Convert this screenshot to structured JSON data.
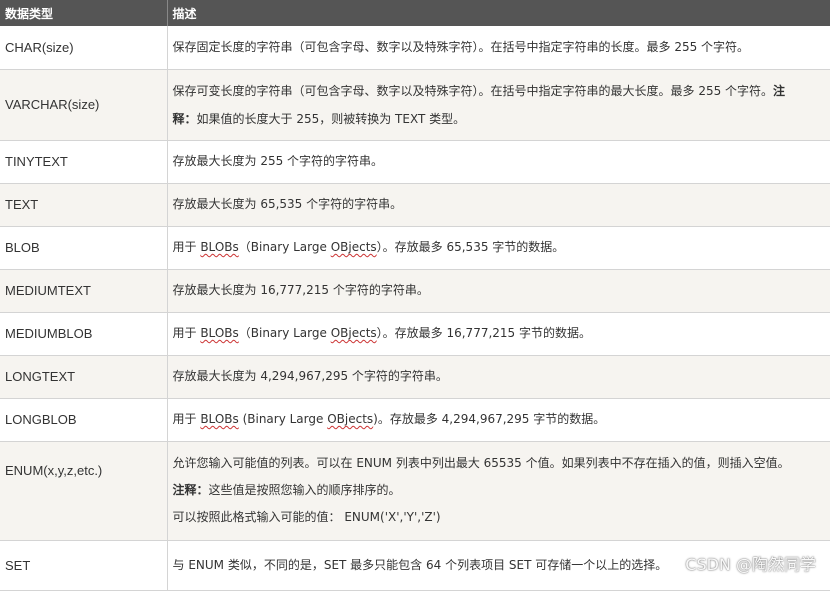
{
  "header": {
    "col_type": "数据类型",
    "col_desc": "描述"
  },
  "rows": [
    {
      "name": "CHAR(size)",
      "desc": "保存固定长度的字符串（可包含字母、数字以及特殊字符）。在括号中指定字符串的长度。最多 255 个字符。"
    },
    {
      "name": "VARCHAR(size)",
      "desc_a": "保存可变长度的字符串（可包含字母、数字以及特殊字符）。在括号中指定字符串的最大长度。最多 255 个字符。",
      "note_a": "注",
      "note_b": "释：",
      "desc_b": "如果值的长度大于 255，则被转换为 TEXT 类型。"
    },
    {
      "name": "TINYTEXT",
      "desc": "存放最大长度为 255 个字符的字符串。"
    },
    {
      "name": "TEXT",
      "desc": "存放最大长度为 65,535 个字符的字符串。"
    },
    {
      "name": "BLOB",
      "pre": "用于 ",
      "link": "BLOBs",
      "mid": "（Binary Large ",
      "link2": "OBjects",
      "post": "）。存放最多 65,535 字节的数据。"
    },
    {
      "name": "MEDIUMTEXT",
      "desc": "存放最大长度为 16,777,215 个字符的字符串。"
    },
    {
      "name": "MEDIUMBLOB",
      "pre": "用于 ",
      "link": "BLOBs",
      "mid": "（Binary Large ",
      "link2": "OBjects",
      "post": "）。存放最多 16,777,215 字节的数据。"
    },
    {
      "name": "LONGTEXT",
      "desc": "存放最大长度为 4,294,967,295 个字符的字符串。"
    },
    {
      "name": "LONGBLOB",
      "pre": "用于 ",
      "link": "BLOBs",
      "mid": " (Binary Large ",
      "link2": "OBjects",
      "post": ")。存放最多 4,294,967,295 字节的数据。"
    },
    {
      "name": "ENUM(x,y,z,etc.)",
      "line1": "允许您输入可能值的列表。可以在 ENUM 列表中列出最大 65535 个值。如果列表中不存在插入的值，则插入空值。",
      "note": "注释：",
      "line2": "这些值是按照您输入的顺序排序的。",
      "line3": "可以按照此格式输入可能的值： ENUM('X','Y','Z')"
    },
    {
      "name": "SET",
      "desc": "与 ENUM 类似，不同的是，SET 最多只能包含 64 个列表项目 SET 可存储一个以上的选择。"
    }
  ],
  "watermark": "CSDN @陶然同学"
}
